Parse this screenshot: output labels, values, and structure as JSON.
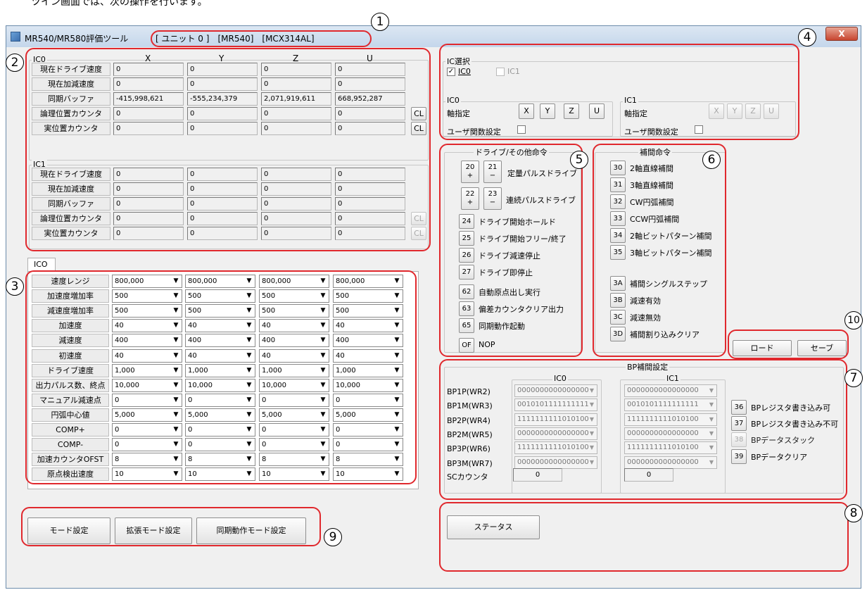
{
  "doc_text": "ツイン画面では、次の操作を行います。",
  "window": {
    "title": "MR540/MR580評価ツール",
    "unit_info": "[ ユニット 0 ]　[MR540]　[MCX314AL]",
    "close_label": "X"
  },
  "callouts": [
    "1",
    "2",
    "3",
    "4",
    "5",
    "6",
    "7",
    "8",
    "9",
    "10"
  ],
  "status_panel": {
    "ic0_label": "IC0",
    "ic1_label": "IC1",
    "columns": [
      "X",
      "Y",
      "Z",
      "U"
    ],
    "ic0_rows": [
      {
        "label": "現在ドライブ速度",
        "values": [
          "0",
          "0",
          "0",
          "0"
        ]
      },
      {
        "label": "現在加減速度",
        "values": [
          "0",
          "0",
          "0",
          "0"
        ]
      },
      {
        "label": "同期バッファ",
        "values": [
          "-415,998,621",
          "-555,234,379",
          "2,071,919,611",
          "668,952,287"
        ]
      },
      {
        "label": "論理位置カウンタ",
        "values": [
          "0",
          "0",
          "0",
          "0"
        ]
      },
      {
        "label": "実位置カウンタ",
        "values": [
          "0",
          "0",
          "0",
          "0"
        ]
      }
    ],
    "ic1_rows": [
      {
        "label": "現在ドライブ速度",
        "values": [
          "0",
          "0",
          "0",
          "0"
        ]
      },
      {
        "label": "現在加減速度",
        "values": [
          "0",
          "0",
          "0",
          "0"
        ]
      },
      {
        "label": "同期バッファ",
        "values": [
          "0",
          "0",
          "0",
          "0"
        ]
      },
      {
        "label": "論理位置カウンタ",
        "values": [
          "0",
          "0",
          "0",
          "0"
        ]
      },
      {
        "label": "実位置カウンタ",
        "values": [
          "0",
          "0",
          "0",
          "0"
        ]
      }
    ],
    "cl_label": "CL"
  },
  "params": {
    "tab": "ICO",
    "rows": [
      {
        "label": "速度レンジ",
        "values": [
          "800,000",
          "800,000",
          "800,000",
          "800,000"
        ]
      },
      {
        "label": "加速度増加率",
        "values": [
          "500",
          "500",
          "500",
          "500"
        ]
      },
      {
        "label": "減速度増加率",
        "values": [
          "500",
          "500",
          "500",
          "500"
        ]
      },
      {
        "label": "加速度",
        "values": [
          "40",
          "40",
          "40",
          "40"
        ]
      },
      {
        "label": "減速度",
        "values": [
          "400",
          "400",
          "400",
          "400"
        ]
      },
      {
        "label": "初速度",
        "values": [
          "40",
          "40",
          "40",
          "40"
        ]
      },
      {
        "label": "ドライブ速度",
        "values": [
          "1,000",
          "1,000",
          "1,000",
          "1,000"
        ]
      },
      {
        "label": "出力パルス数、終点",
        "values": [
          "10,000",
          "10,000",
          "10,000",
          "10,000"
        ]
      },
      {
        "label": "マニュアル減速点",
        "values": [
          "0",
          "0",
          "0",
          "0"
        ]
      },
      {
        "label": "円弧中心値",
        "values": [
          "5,000",
          "5,000",
          "5,000",
          "5,000"
        ]
      },
      {
        "label": "COMP+",
        "values": [
          "0",
          "0",
          "0",
          "0"
        ]
      },
      {
        "label": "COMP-",
        "values": [
          "0",
          "0",
          "0",
          "0"
        ]
      },
      {
        "label": "加速カウンタOFST",
        "values": [
          "8",
          "8",
          "8",
          "8"
        ]
      },
      {
        "label": "原点検出速度",
        "values": [
          "10",
          "10",
          "10",
          "10"
        ]
      }
    ]
  },
  "mode_buttons": {
    "mode": "モード設定",
    "ext_mode": "拡張モード設定",
    "sync_mode": "同期動作モード設定"
  },
  "ic_select": {
    "title": "IC選択",
    "ic0": "IC0",
    "ic1": "IC1",
    "ic0_checked": true,
    "ic0_group": "IC0",
    "ic1_group": "IC1",
    "axis_label": "軸指定",
    "user_func_label": "ユーザ関数設定",
    "axes": [
      "X",
      "Y",
      "Z",
      "U"
    ]
  },
  "drive": {
    "title": "ドライブ/その他命令",
    "pulse_buttons": [
      {
        "num": "20",
        "sign": "+"
      },
      {
        "num": "21",
        "sign": "−"
      },
      {
        "num": "22",
        "sign": "+"
      },
      {
        "num": "23",
        "sign": "−"
      }
    ],
    "fixed_pulse": "定量パルスドライブ",
    "cont_pulse": "連続パルスドライブ",
    "commands": [
      {
        "code": "24",
        "label": "ドライブ開始ホールド"
      },
      {
        "code": "25",
        "label": "ドライブ開始フリー/終了"
      },
      {
        "code": "26",
        "label": "ドライブ減速停止"
      },
      {
        "code": "27",
        "label": "ドライブ即停止"
      },
      {
        "code": "62",
        "label": "自動原点出し実行"
      },
      {
        "code": "63",
        "label": "偏差カウンタクリア出力"
      },
      {
        "code": "65",
        "label": "同期動作起動"
      },
      {
        "code": "OF",
        "label": "NOP"
      }
    ]
  },
  "interp": {
    "title": "補間命令",
    "commands": [
      {
        "code": "30",
        "label": "2軸直線補間"
      },
      {
        "code": "31",
        "label": "3軸直線補間"
      },
      {
        "code": "32",
        "label": "CW円弧補間"
      },
      {
        "code": "33",
        "label": "CCW円弧補間"
      },
      {
        "code": "34",
        "label": "2軸ビットパターン補間"
      },
      {
        "code": "35",
        "label": "3軸ビットパターン補間"
      },
      {
        "code": "3A",
        "label": "補間シングルステップ"
      },
      {
        "code": "3B",
        "label": "減速有効"
      },
      {
        "code": "3C",
        "label": "減速無効"
      },
      {
        "code": "3D",
        "label": "補間割り込みクリア"
      }
    ]
  },
  "file_buttons": {
    "load": "ロード",
    "save": "セーブ"
  },
  "bp": {
    "title": "BP補間設定",
    "ic0": "IC0",
    "ic1": "IC1",
    "rows": [
      {
        "label": "BP1P(WR2)",
        "ic0": "0000000000000000",
        "ic1": "0000000000000000"
      },
      {
        "label": "BP1M(WR3)",
        "ic0": "0010101111111111",
        "ic1": "0010101111111111"
      },
      {
        "label": "BP2P(WR4)",
        "ic0": "1111111111010100",
        "ic1": "1111111111010100"
      },
      {
        "label": "BP2M(WR5)",
        "ic0": "0000000000000000",
        "ic1": "0000000000000000"
      },
      {
        "label": "BP3P(WR6)",
        "ic0": "1111111111010100",
        "ic1": "1111111111010100"
      },
      {
        "label": "BP3M(WR7)",
        "ic0": "0000000000000000",
        "ic1": "0000000000000000"
      }
    ],
    "commands": [
      {
        "code": "36",
        "label": "BPレジスタ書き込み可",
        "disabled": false
      },
      {
        "code": "37",
        "label": "BPレジスタ書き込み不可",
        "disabled": false
      },
      {
        "code": "38",
        "label": "BPデータスタック",
        "disabled": true
      },
      {
        "code": "39",
        "label": "BPデータクリア",
        "disabled": false
      }
    ],
    "sc_label": "SCカウンタ",
    "sc_ic0": "0",
    "sc_ic1": "0"
  },
  "status_button": "ステータス"
}
